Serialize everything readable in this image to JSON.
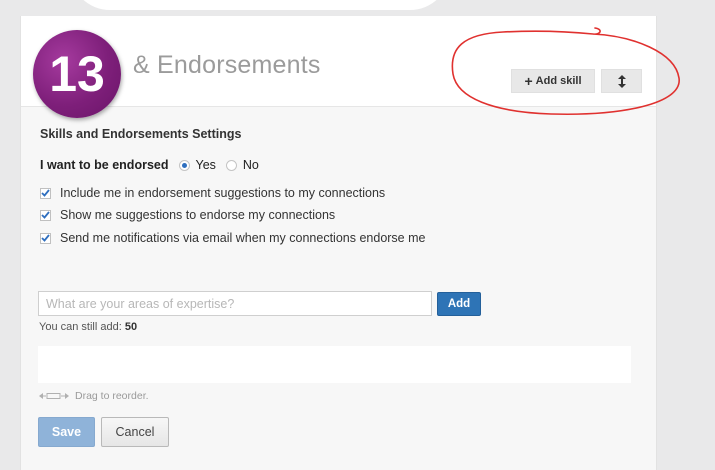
{
  "step": {
    "number": "13"
  },
  "header": {
    "title": "& Endorsements",
    "add_skill_label": "Add skill",
    "add_skill_icon": "plus-icon",
    "reorder_icon": "vertical-arrows-icon"
  },
  "settings": {
    "title": "Skills and Endorsements Settings",
    "endorse_question": "I want to be endorsed",
    "options": {
      "yes": "Yes",
      "no": "No"
    },
    "selected": "Yes",
    "checkboxes": [
      {
        "label": "Include me in endorsement suggestions to my connections",
        "checked": true
      },
      {
        "label": "Show me suggestions to endorse my connections",
        "checked": true
      },
      {
        "label": "Send me notifications via email when my connections endorse me",
        "checked": true
      }
    ]
  },
  "skills": {
    "input_placeholder": "What are your areas of expertise?",
    "input_value": "",
    "add_label": "Add",
    "remaining_prefix": "You can still add:",
    "remaining_count": "50",
    "drag_hint": "Drag to reorder."
  },
  "actions": {
    "save_label": "Save",
    "cancel_label": "Cancel"
  },
  "colors": {
    "badge": "#7e1f7a",
    "primary_button": "#2e74b6",
    "save_button": "#8fb3d9",
    "annotation": "#e0312f"
  }
}
